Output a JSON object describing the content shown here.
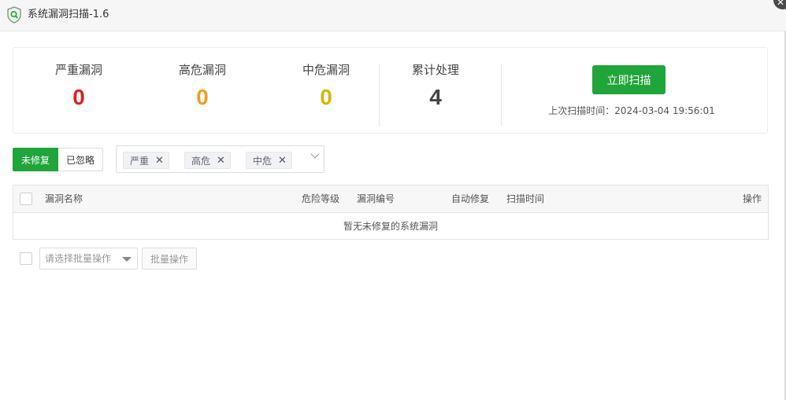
{
  "window": {
    "title": "系统漏洞扫描-1.6",
    "close_icon": "close-icon"
  },
  "summary": {
    "stats": [
      {
        "label": "严重漏洞",
        "value": "0",
        "color": "#e02020"
      },
      {
        "label": "高危漏洞",
        "value": "0",
        "color": "#f0a020"
      },
      {
        "label": "中危漏洞",
        "value": "0",
        "color": "#d4b800"
      },
      {
        "label": "累计处理",
        "value": "4",
        "color": "#444444"
      }
    ],
    "scan_button": "立即扫描",
    "last_scan": "上次扫描时间：2024-03-04 19:56:01"
  },
  "tabs": {
    "unfixed": "未修复",
    "ignored": "已忽略"
  },
  "filter": {
    "chips": [
      "严重",
      "高危",
      "中危"
    ]
  },
  "table": {
    "columns": {
      "name": "漏洞名称",
      "level": "危险等级",
      "number": "漏洞编号",
      "auto_fix": "自动修复",
      "scan_time": "扫描时间",
      "action": "操作"
    },
    "empty": "暂无未修复的系统漏洞"
  },
  "batch": {
    "placeholder": "请选择批量操作",
    "button": "批量操作"
  },
  "colors": {
    "accent": "#20a53a"
  }
}
